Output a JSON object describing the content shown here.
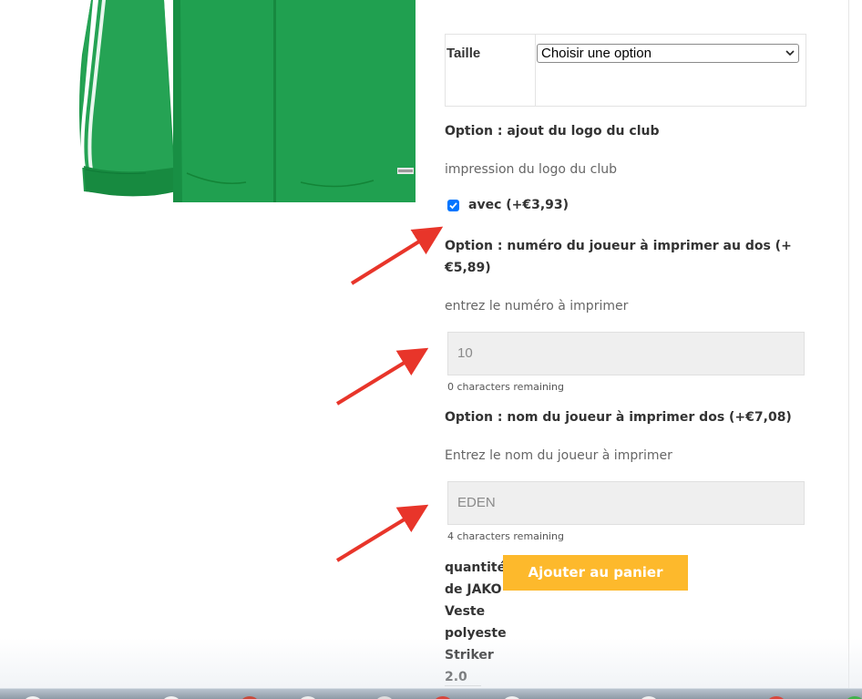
{
  "product": {
    "image_icon": "green-jacket-image"
  },
  "variations": {
    "label": "Taille",
    "select_value": "Choisir une option"
  },
  "logo_option": {
    "heading": "Option : ajout du logo du club",
    "description": "impression du logo du club",
    "checkbox_label": "avec (+€3,93)",
    "checked": true
  },
  "number_option": {
    "heading_line1": "Option : numéro du joueur à imprimer au dos (+",
    "heading_line2": "€5,89)",
    "description": "entrez le numéro à imprimer",
    "value": "10",
    "remaining": "0 characters remaining"
  },
  "name_option": {
    "heading": "Option : nom du joueur à imprimer dos (+€7,08)",
    "description": "Entrez le nom du joueur à imprimer",
    "value": "EDEN",
    "remaining": "4 characters remaining"
  },
  "quantity": {
    "label_lines": [
      "quantité",
      "de JAKO",
      "Veste",
      "polyeste",
      "Striker",
      "2.0"
    ]
  },
  "add_to_cart": {
    "label": "Ajouter au panier"
  },
  "colors": {
    "accent": "#fdb92c",
    "jacket_green": "#1e9a4b",
    "arrow_red": "#e8352a",
    "checkbox_blue": "#0075ff"
  }
}
